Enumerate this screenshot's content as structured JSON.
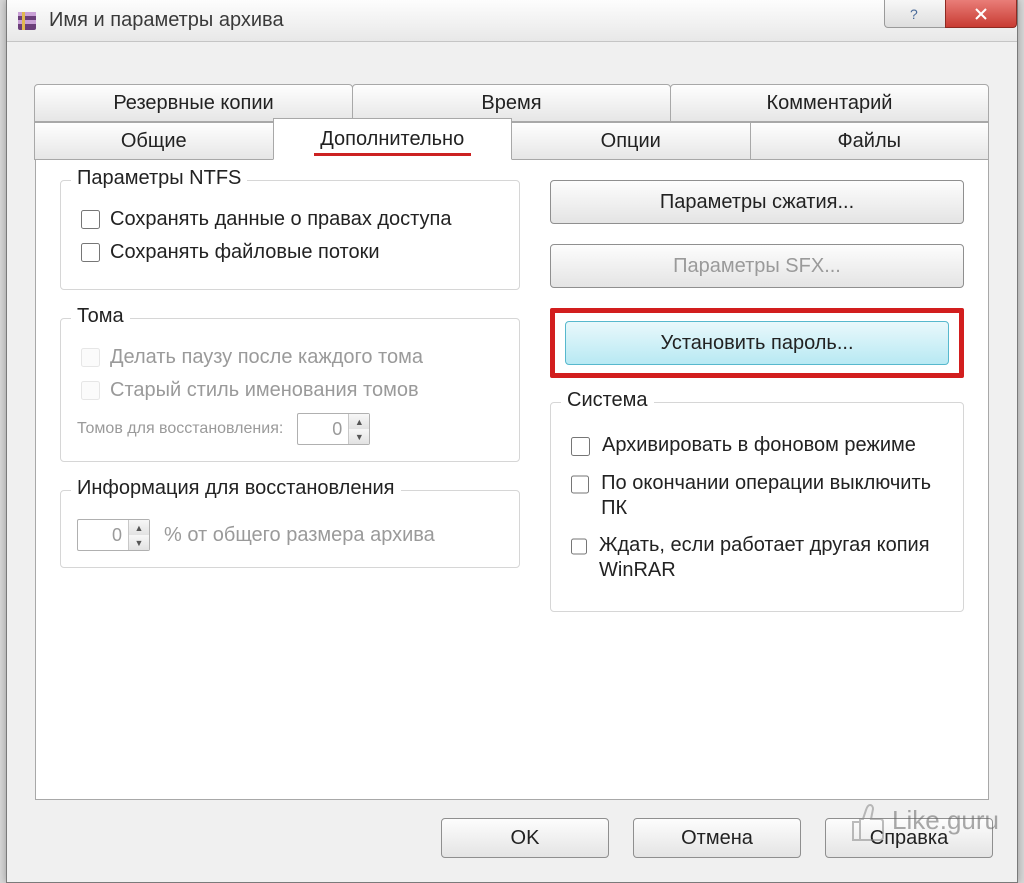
{
  "window": {
    "title": "Имя и параметры архива"
  },
  "tabs_row1": [
    {
      "label": "Резервные копии"
    },
    {
      "label": "Время"
    },
    {
      "label": "Комментарий"
    }
  ],
  "tabs_row2": [
    {
      "label": "Общие"
    },
    {
      "label": "Дополнительно"
    },
    {
      "label": "Опции"
    },
    {
      "label": "Файлы"
    }
  ],
  "groups": {
    "ntfs": {
      "title": "Параметры NTFS",
      "save_acl": "Сохранять данные о правах доступа",
      "save_streams": "Сохранять файловые потоки"
    },
    "volumes": {
      "title": "Тома",
      "pause_each": "Делать паузу после каждого тома",
      "old_naming": "Старый стиль именования томов",
      "recovery_label": "Томов для восстановления:",
      "recovery_value": "0"
    },
    "recovery_info": {
      "title": "Информация для восстановления",
      "percent_value": "0",
      "percent_label": "% от общего размера архива"
    },
    "system": {
      "title": "Система",
      "background": "Архивировать в фоновом режиме",
      "shutdown": "По окончании операции выключить ПК",
      "wait_other": "Ждать, если работает другая копия WinRAR"
    }
  },
  "buttons": {
    "compression": "Параметры сжатия...",
    "sfx": "Параметры SFX...",
    "password": "Установить пароль...",
    "ok": "OK",
    "cancel": "Отмена",
    "help": "Справка"
  },
  "watermark": "Like.guru"
}
